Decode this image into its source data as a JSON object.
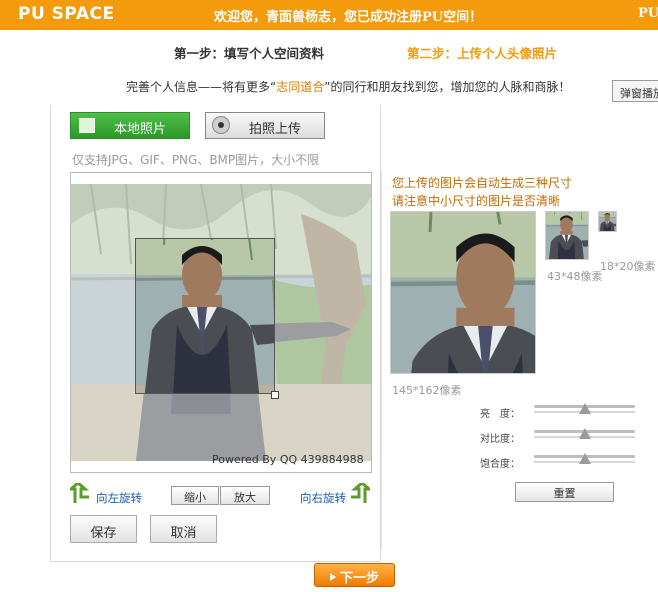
{
  "header": {
    "logo": "PU SPACE",
    "welcome": "欢迎您，青面兽杨志，您已成功注册PU空间！",
    "right_fragment": "PU"
  },
  "steps": {
    "step1": "第一步：填写个人空间资料",
    "step2": "第二步：上传个人头像照片"
  },
  "intro": {
    "before": "完善个人信息——将有更多“",
    "highlight": "志同道合",
    "after": "”的同行和朋友找到您，增加您的人脉和商脉！"
  },
  "popup_tab": "弹窗播放",
  "upload": {
    "local_label": "本地照片",
    "camera_label": "拍照上传",
    "hint": "仅支持JPG、GIF、PNG、BMP图片，大小不限"
  },
  "editor": {
    "powered_by": "Powered By QQ 439884988",
    "rotate_left": "向左旋转",
    "rotate_right": "向右旋转",
    "zoom_out": "缩小",
    "zoom_in": "放大",
    "save": "保存",
    "cancel": "取消"
  },
  "preview": {
    "tip1": "您上传的图片会自动生成三种尺寸",
    "tip2": "请注意中小尺寸的图片是否清晰",
    "size_large": "145*162像素",
    "size_medium": "43*48像素",
    "size_small": "18*20像素"
  },
  "adjust": {
    "brightness_label": "亮　度：",
    "contrast_label": "对比度：",
    "saturation_label": "饱合度：",
    "brightness": 0.5,
    "contrast": 0.5,
    "saturation": 0.5,
    "reset": "重置"
  },
  "next_button": "下一步",
  "colors": {
    "accent": "#f39a0d",
    "green": "#3aab36"
  }
}
